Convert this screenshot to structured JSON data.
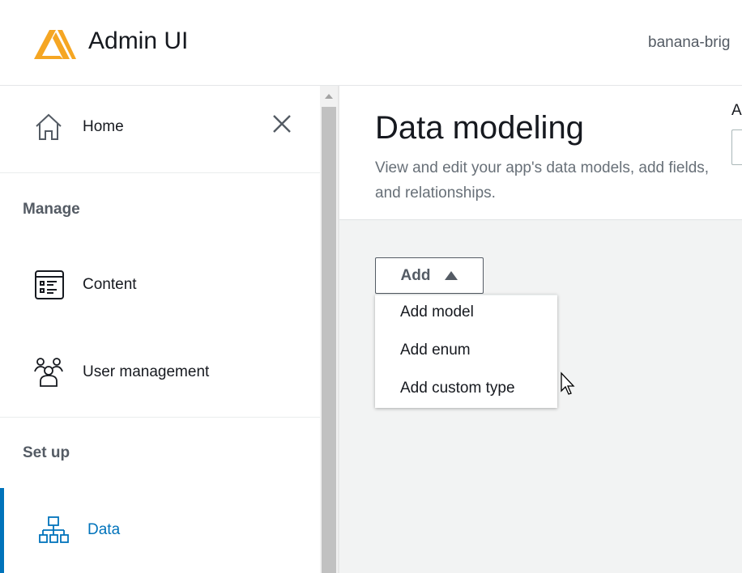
{
  "header": {
    "app_title": "Admin UI",
    "environment": "banana-brig",
    "logo_color": "#f5a623"
  },
  "sidebar": {
    "home": "Home",
    "sections": [
      {
        "title": "Manage",
        "items": [
          {
            "label": "Content",
            "icon": "content-list-icon"
          },
          {
            "label": "User management",
            "icon": "users-icon"
          }
        ]
      },
      {
        "title": "Set up",
        "items": [
          {
            "label": "Data",
            "icon": "data-hierarchy-icon",
            "active": true
          }
        ]
      }
    ],
    "active_color": "#0073bb"
  },
  "main": {
    "title": "Data modeling",
    "description": "View and edit your app's data models, add fields, and relationships.",
    "cut_label": "A",
    "add_button": "Add",
    "add_menu": [
      "Add model",
      "Add enum",
      "Add custom type"
    ]
  }
}
